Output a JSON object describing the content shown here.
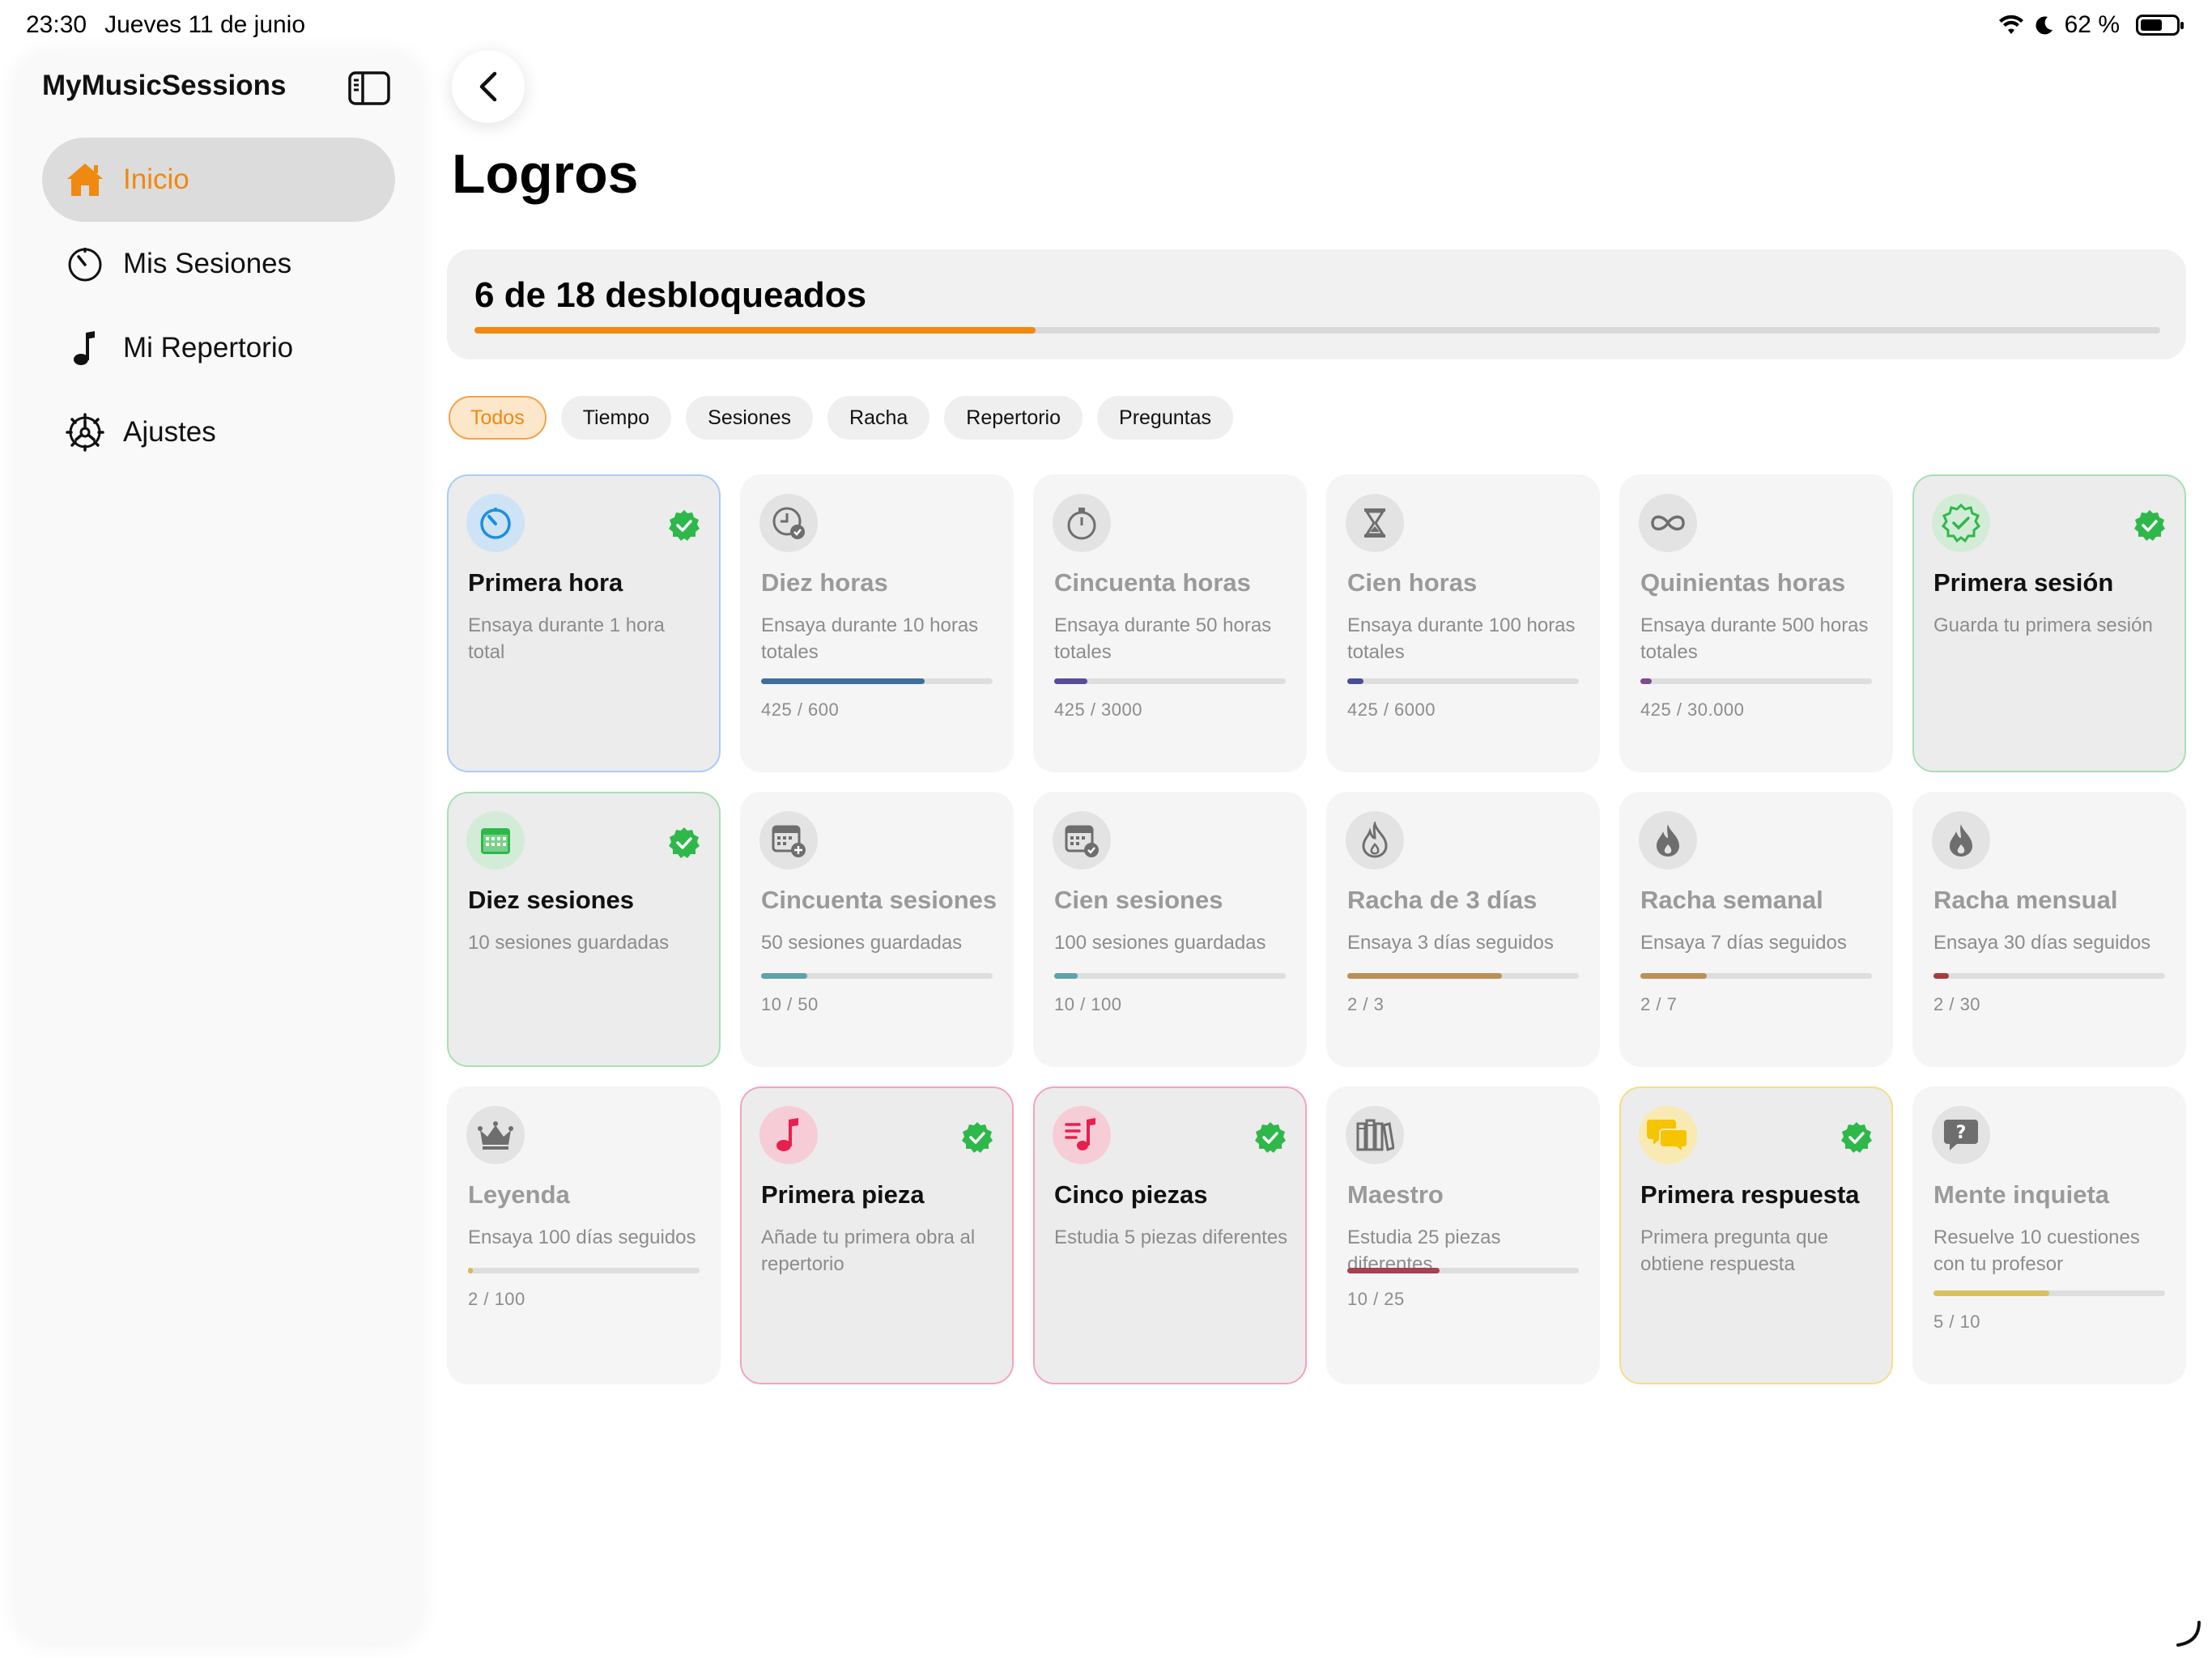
{
  "status": {
    "time": "23:30",
    "date": "Jueves 11 de junio",
    "battery": "62 %",
    "battery_level": 0.62
  },
  "sidebar": {
    "title": "MyMusicSessions",
    "items": [
      {
        "label": "Inicio",
        "icon": "house-icon"
      },
      {
        "label": "Mis Sesiones",
        "icon": "timer-icon"
      },
      {
        "label": "Mi Repertorio",
        "icon": "music-note-icon"
      },
      {
        "label": "Ajustes",
        "icon": "gear-icon"
      }
    ]
  },
  "main": {
    "title": "Logros",
    "progress_text": "6 de 18 desbloqueados",
    "progress_value": 0.333,
    "accent_color": "#f0890f",
    "filters": [
      "Todos",
      "Tiempo",
      "Sesiones",
      "Racha",
      "Repertorio",
      "Preguntas"
    ]
  },
  "achievements": [
    {
      "title": "Primera hora",
      "desc": "Ensaya durante 1 hora total",
      "unlocked": true,
      "icon": "timer-icon",
      "color": "#1a8fe3",
      "border": "#a9cdf2",
      "circle": "#cfe3f6"
    },
    {
      "title": "Diez horas",
      "desc": "Ensaya durante 10 horas totales",
      "unlocked": false,
      "icon": "clock-check-icon",
      "progress": 0.708,
      "count": "425 / 600",
      "barColor": "#3f6f9e"
    },
    {
      "title": "Cincuenta horas",
      "desc": "Ensaya durante 50 horas totales",
      "unlocked": false,
      "icon": "stopwatch-icon",
      "progress": 0.142,
      "count": "425 / 3000",
      "barColor": "#5a4c9a"
    },
    {
      "title": "Cien horas",
      "desc": "Ensaya durante 100 horas totales",
      "unlocked": false,
      "icon": "hourglass-icon",
      "progress": 0.071,
      "count": "425 / 6000",
      "barColor": "#4a4d99"
    },
    {
      "title": "Quinientas horas",
      "desc": "Ensaya durante 500 horas totales",
      "unlocked": false,
      "icon": "infinity-icon",
      "progress": 0.05,
      "count": "425 / 30.000",
      "barColor": "#7a4d8c"
    },
    {
      "title": "Primera sesión",
      "desc": "Guarda tu primera sesión",
      "unlocked": true,
      "icon": "seal-check-icon",
      "color": "#2fb84a",
      "border": "#a8e0b3",
      "circle": "#d3ecd8"
    },
    {
      "title": "Diez sesiones",
      "desc": "10 sesiones guardadas",
      "unlocked": true,
      "icon": "calendar-icon",
      "color": "#2fb84a",
      "border": "#a8e0b3",
      "circle": "#d3ecd8"
    },
    {
      "title": "Cincuenta sesiones",
      "desc": "50 sesiones guardadas",
      "unlocked": false,
      "icon": "calendar-plus-icon",
      "progress": 0.2,
      "count": "10 / 50",
      "barColor": "#5ea3a8"
    },
    {
      "title": "Cien sesiones",
      "desc": "100 sesiones guardadas",
      "unlocked": false,
      "icon": "calendar-check-icon",
      "progress": 0.1,
      "count": "10 / 100",
      "barColor": "#5ea3a8"
    },
    {
      "title": "Racha de 3 días",
      "desc": "Ensaya 3 días seguidos",
      "unlocked": false,
      "icon": "flame-outline-icon",
      "progress": 0.667,
      "count": "2 / 3",
      "barColor": "#bb9055"
    },
    {
      "title": "Racha semanal",
      "desc": "Ensaya 7 días seguidos",
      "unlocked": false,
      "icon": "flame-icon",
      "progress": 0.286,
      "count": "2 / 7",
      "barColor": "#bb9055"
    },
    {
      "title": "Racha mensual",
      "desc": "Ensaya 30 días seguidos",
      "unlocked": false,
      "icon": "flame-icon",
      "progress": 0.067,
      "count": "2 / 30",
      "barColor": "#a63c3c"
    },
    {
      "title": "Leyenda",
      "desc": "Ensaya 100 días seguidos",
      "unlocked": false,
      "icon": "crown-icon",
      "progress": 0.02,
      "count": "2 / 100",
      "barColor": "#d8b85a"
    },
    {
      "title": "Primera pieza",
      "desc": "Añade tu primera obra al repertorio",
      "unlocked": true,
      "icon": "music-note-icon",
      "color": "#e8204f",
      "border": "#f0a6b7",
      "circle": "#f6cdd6"
    },
    {
      "title": "Cinco piezas",
      "desc": "Estudia 5 piezas diferentes",
      "unlocked": true,
      "icon": "music-list-icon",
      "color": "#e8204f",
      "border": "#f0a6b7",
      "circle": "#f6cdd6"
    },
    {
      "title": "Maestro",
      "desc": "Estudia 25 piezas diferentes",
      "unlocked": false,
      "icon": "books-icon",
      "progress": 0.4,
      "count": "10 / 25",
      "barColor": "#a34250"
    },
    {
      "title": "Primera respuesta",
      "desc": "Primera pregunta que obtiene respuesta",
      "unlocked": true,
      "icon": "chat-bubbles-icon",
      "color": "#f6c400",
      "border": "#f3de8a",
      "circle": "#f8eab2"
    },
    {
      "title": "Mente inquieta",
      "desc": "Resuelve 10 cuestiones con tu profesor",
      "unlocked": false,
      "icon": "question-bubble-icon",
      "progress": 0.5,
      "count": "5 / 10",
      "barColor": "#d8c15e"
    }
  ]
}
